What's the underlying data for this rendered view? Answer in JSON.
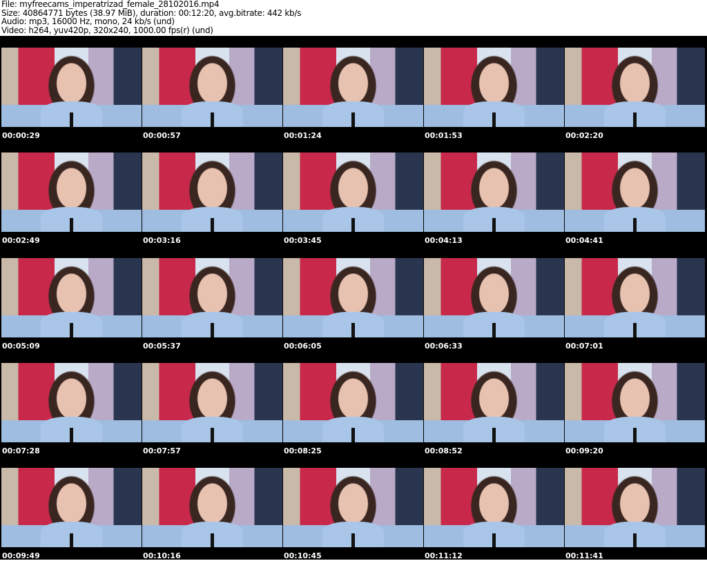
{
  "header": {
    "file": "File: myfreecams_imperatrizad_female_28102016.mp4",
    "size": "Size: 40864771 bytes (38.97 MiB), duration: 00:12:20, avg.bitrate: 442 kb/s",
    "audio": "Audio: mp3, 16000 Hz, mono, 24 kb/s (und)",
    "video": "Video: h264, yuv420p, 320x240, 1000.00 fps(r) (und)"
  },
  "thumbnails": [
    "00:00:29",
    "00:00:57",
    "00:01:24",
    "00:01:53",
    "00:02:20",
    "00:02:49",
    "00:03:16",
    "00:03:45",
    "00:04:13",
    "00:04:41",
    "00:05:09",
    "00:05:37",
    "00:06:05",
    "00:06:33",
    "00:07:01",
    "00:07:28",
    "00:07:57",
    "00:08:25",
    "00:08:52",
    "00:09:20",
    "00:09:49",
    "00:10:16",
    "00:10:45",
    "00:11:12",
    "00:11:41"
  ]
}
